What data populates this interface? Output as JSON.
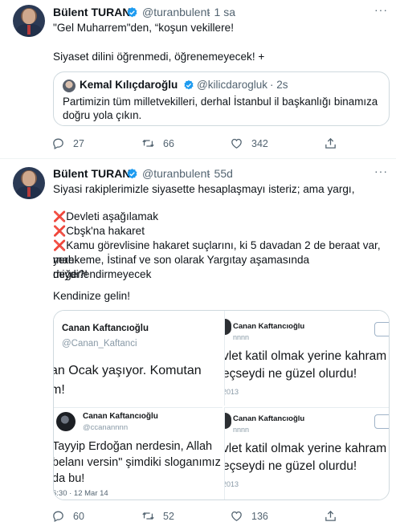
{
  "tweet1": {
    "name": "Bülent TURAN",
    "handle": "@turanbulent",
    "time": "· 1 sa",
    "line1": "\"Gel Muharrem\"den, “koşun vekillere!",
    "line2": "Siyaset dilini öğrenmedi, öğrenemeyecek! +",
    "quote": {
      "name": "Kemal Kılıçdaroğlu",
      "handle": "@kilicdarogluk",
      "time": "· 2s",
      "line1": "Partimizin tüm milletvekilleri, derhal İstanbul il başkanlığı binamıza",
      "line2": "doğru yola çıkın."
    },
    "replies": "27",
    "retweets": "66",
    "likes": "342"
  },
  "tweet2": {
    "name": "Bülent TURAN",
    "handle": "@turanbulent",
    "time": "· 55d",
    "line1": "Siyasi rakiplerimizle siyasette hesaplaşmayı isteriz; ama yargı,",
    "bullet_mark": "❌",
    "bullet1": "Devleti aşağılamak",
    "bullet2": "Cbşk'na hakaret",
    "bullet3a": "Kamu görevlisine hakaret suçlarını, ki 5 davadan 2 de beraat var, yerel",
    "bullet3b": "mahkeme, İstinaf ve son olarak Yargıtay aşamasında değerlendirmeyecek",
    "bullet3c": "miydi?!",
    "closing": "Kendinize gelin!",
    "media": {
      "p1_name": "Canan Kaftancıoğlu",
      "p1_handle": "@Canan_Kaftanci",
      "p1_line1": "an Ocak yaşıyor. Komutan",
      "p1_line2": "m!",
      "p2_name": "Canan Kaftancıoğlu",
      "p2_handle": "nnnn",
      "p2_line1": "vlet katil olmak yerine kahram",
      "p2_line2": "eçseydi ne güzel olurdu!",
      "p2_date": "2013",
      "p3_name": "Canan Kaftancıoğlu",
      "p3_handle": "@ccanannnn",
      "p3_line1": "Tayyip Erdoğan nerdesin, Allah",
      "p3_line2": "belanı versin\" şimdiki sloganımız",
      "p3_line3": "da bu!",
      "p3_date": "6:30 · 12 Mar 14",
      "p4_name": "Canan Kaftancıoğlu",
      "p4_handle": "nnnn",
      "p4_line1": "vlet katil olmak yerine kahram",
      "p4_line2": "eçseydi ne güzel olurdu!",
      "p4_date": "2013"
    },
    "replies": "60",
    "retweets": "52",
    "likes": "136"
  },
  "colors": {
    "verified": "#1d9bf0",
    "secondary_text": "#536471",
    "border": "#cfd9de",
    "red_x": "#dd2e44"
  },
  "icons": [
    "verified-badge-icon",
    "more-icon",
    "reply-icon",
    "retweet-icon",
    "like-icon",
    "share-icon",
    "red-x-icon"
  ]
}
